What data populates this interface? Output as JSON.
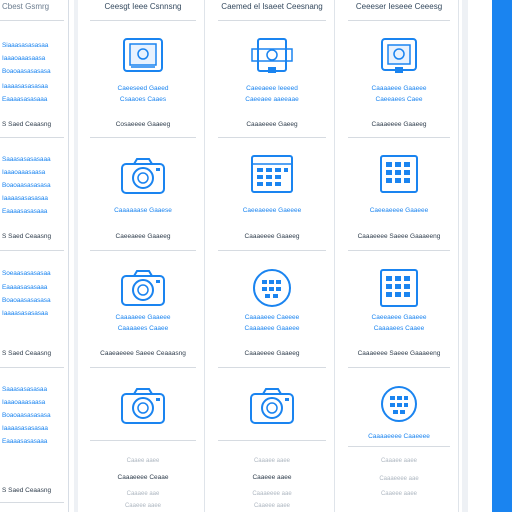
{
  "left": {
    "header": "Cbest Gsmrg",
    "groups": [
      {
        "items": [
          "Siaaasasasasaa",
          "Iaaaoaaasaasa",
          "Boaoaasasasasa",
          "Iaaaasasasasaa",
          "Eaaaasasasaaa"
        ],
        "footer": "S Saed Ceaasng"
      },
      {
        "items": [
          "Saaasasasasaaa",
          "Iaaaoaaasaasa",
          "Boaoaasasasasa",
          "Iaaaasasasasaa",
          "Eaaaasasasaaa"
        ],
        "footer": "S Saed Ceaasng"
      },
      {
        "items": [
          "Soeaasasasasaa",
          "Eaaaasasasaaa",
          "Boaoaasasasasa",
          "Iaaaasasasasaa"
        ],
        "footer": "S Saed Ceaasng"
      },
      {
        "items": [
          "Saaasasasasaa",
          "Iaaaoaaasaasa",
          "Boaoaasasasasa",
          "Iaaaasasasasaa",
          "Eaaaasasasaaa"
        ],
        "footer": "S Saed Ceaasng"
      }
    ]
  },
  "columns": [
    {
      "header": "Ceesgt Ieee Csnnsng",
      "cells": [
        {
          "icon": "frame-icon",
          "caption": [
            "Caeeseed Gaeed",
            "Csaaoes Caaes"
          ],
          "section": "Cosaeeee Gaaeeg"
        },
        {
          "icon": "camera-icon",
          "caption": [
            "Caaaaaase Gaaese"
          ],
          "section": "Caeeaeee Gaaeeg"
        },
        {
          "icon": "camera-icon",
          "caption": [
            "Caaaaeee Gaaeee",
            "Caaaaees Caaee"
          ],
          "section": "Caaeaeeee Saeee Ceaaasng"
        },
        {
          "icon": "camera-icon",
          "caption": [],
          "section": "Caaaeeee Ceaae"
        }
      ],
      "faint": [
        "Caaee aaee",
        "Caaaee aae",
        "Caaeee aaee"
      ]
    },
    {
      "header": "Caemed el Isaeet Ceesnang",
      "cells": [
        {
          "icon": "frame-icon",
          "caption": [
            "Caeeaeee Ieeeed",
            "Caeeaee aaeeaae"
          ],
          "section": "Caaaeeee Gaeeg"
        },
        {
          "icon": "grid-icon",
          "caption": [
            "Caeeaeeee Gaeeee"
          ],
          "section": "Caaaeeee Gaaeeg"
        },
        {
          "icon": "globe-icon",
          "caption": [
            "Caaaaeee Caeeee",
            "Caaaaeee Gaaeee"
          ],
          "section": "Caaaeeee Gaaeeg"
        },
        {
          "icon": "camera-icon",
          "caption": [],
          "section": "Caaeee aaee"
        }
      ],
      "faint": [
        "Caaaee aaee",
        "Caaaeeee aae",
        "Caaeee aaee"
      ]
    },
    {
      "header": "Ceeeser Ieseee Ceeesg",
      "cells": [
        {
          "icon": "frame-icon",
          "caption": [
            "Caaaaeee Gaaeee",
            "Caeeaees Caee"
          ],
          "section": "Caaaeeee Gaaeeg"
        },
        {
          "icon": "grid-icon",
          "caption": [
            "Caeeaeeee Gaaeee"
          ],
          "section": "Caaaeeee Saeee Gaaaeeng"
        },
        {
          "icon": "grid-icon",
          "caption": [
            "Caeeaeee Gaaeee",
            "Caaaaees Caaee"
          ],
          "section": "Caaaeeee Saeee Gaaaeeng"
        },
        {
          "icon": "globe-icon",
          "caption": [
            "Caaaaeeee Caaeeee"
          ],
          "section": ""
        }
      ],
      "faint": [
        "Caaaee aaee",
        "Caaaeeee aae",
        "Caaeee aaee"
      ]
    }
  ],
  "colors": {
    "accent": "#1a84f0",
    "text": "#2f3d4c",
    "rule": "#d6dbe1"
  }
}
